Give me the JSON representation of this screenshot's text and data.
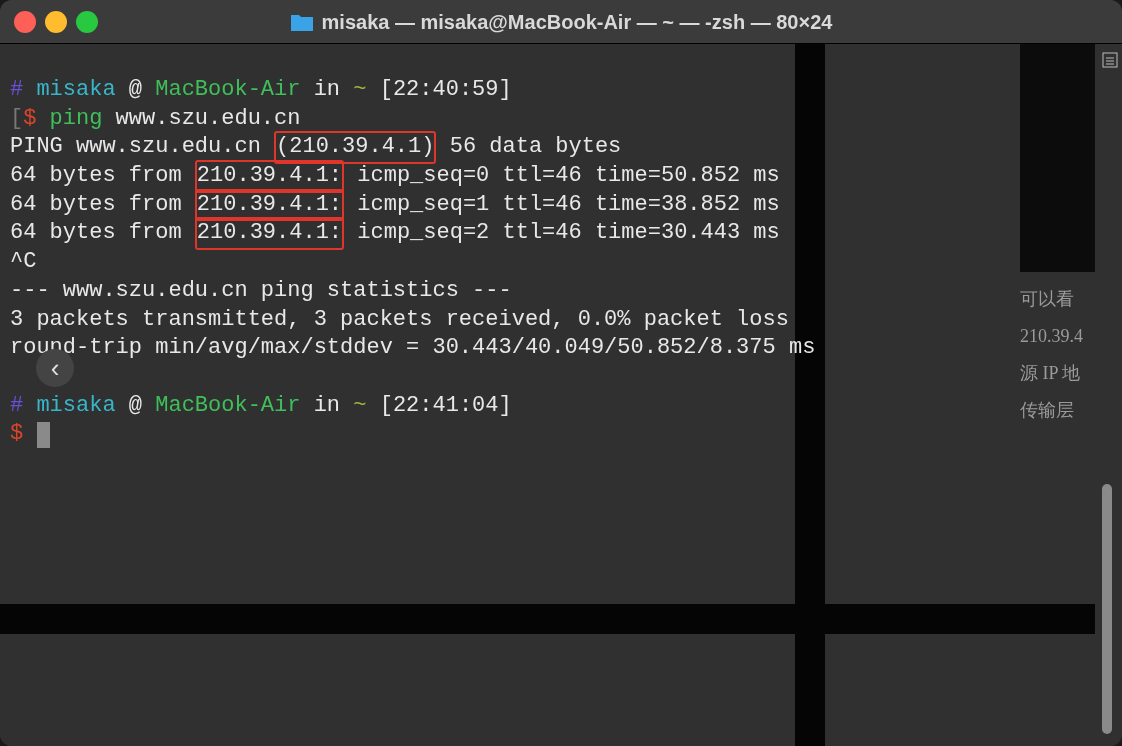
{
  "window": {
    "title": "misaka — misaka@MacBook-Air — ~ — -zsh — 80×24"
  },
  "terminal": {
    "blocks": [
      {
        "lines": [
          {
            "segments": [
              {
                "text": "#",
                "kind": "hash"
              },
              {
                "text": " misaka",
                "kind": "user"
              },
              {
                "text": " @ ",
                "kind": "plain"
              },
              {
                "text": "MacBook-Air",
                "kind": "host"
              },
              {
                "text": " in ",
                "kind": "plain"
              },
              {
                "text": "~",
                "kind": "tilde"
              },
              {
                "text": " [22:40:59]",
                "kind": "plain"
              }
            ]
          },
          {
            "segments": [
              {
                "text": "[",
                "kind": "dim"
              },
              {
                "text": "$",
                "kind": "dollar"
              },
              {
                "text": " ping",
                "kind": "command"
              },
              {
                "text": " www.szu.edu.cn",
                "kind": "plain"
              }
            ]
          },
          {
            "segments": [
              {
                "text": "PING www.szu.edu.cn ",
                "kind": "plain"
              },
              {
                "text": "(210.39.4.1)",
                "kind": "plain",
                "boxed": true
              },
              {
                "text": " 56 data bytes",
                "kind": "plain"
              }
            ]
          },
          {
            "segments": [
              {
                "text": "64 bytes from ",
                "kind": "plain"
              },
              {
                "text": "210.39.4.1:",
                "kind": "plain",
                "boxed": true
              },
              {
                "text": " icmp_seq=0 ttl=46 time=50.852 ms",
                "kind": "plain"
              }
            ]
          },
          {
            "segments": [
              {
                "text": "64 bytes from ",
                "kind": "plain"
              },
              {
                "text": "210.39.4.1:",
                "kind": "plain",
                "boxed": true
              },
              {
                "text": " icmp_seq=1 ttl=46 time=38.852 ms",
                "kind": "plain"
              }
            ]
          },
          {
            "segments": [
              {
                "text": "64 bytes from ",
                "kind": "plain"
              },
              {
                "text": "210.39.4.1:",
                "kind": "plain",
                "boxed": true
              },
              {
                "text": " icmp_seq=2 ttl=46 time=30.443 ms",
                "kind": "plain"
              }
            ]
          },
          {
            "segments": [
              {
                "text": "^C",
                "kind": "plain"
              }
            ]
          },
          {
            "segments": [
              {
                "text": "--- www.szu.edu.cn ping statistics ---",
                "kind": "plain"
              }
            ]
          },
          {
            "segments": [
              {
                "text": "3 packets transmitted, 3 packets received, 0.0% packet loss",
                "kind": "plain"
              }
            ]
          },
          {
            "segments": [
              {
                "text": "round-trip min/avg/max/stddev = 30.443/40.049/50.852/8.375 ms",
                "kind": "plain"
              }
            ]
          }
        ]
      },
      {
        "lines": [
          {
            "segments": [
              {
                "text": "#",
                "kind": "hash"
              },
              {
                "text": " misaka",
                "kind": "user"
              },
              {
                "text": " @ ",
                "kind": "plain"
              },
              {
                "text": "MacBook-Air",
                "kind": "host"
              },
              {
                "text": " in ",
                "kind": "plain"
              },
              {
                "text": "~",
                "kind": "tilde"
              },
              {
                "text": " [22:41:04]",
                "kind": "plain"
              }
            ]
          },
          {
            "segments": [
              {
                "text": "$",
                "kind": "dollar"
              }
            ],
            "cursor": true
          }
        ]
      }
    ]
  },
  "background_document": {
    "lines": [
      "可以看",
      "210.39.4",
      "源 IP 地",
      "传输层"
    ]
  },
  "nav_button": {
    "label": "‹"
  }
}
